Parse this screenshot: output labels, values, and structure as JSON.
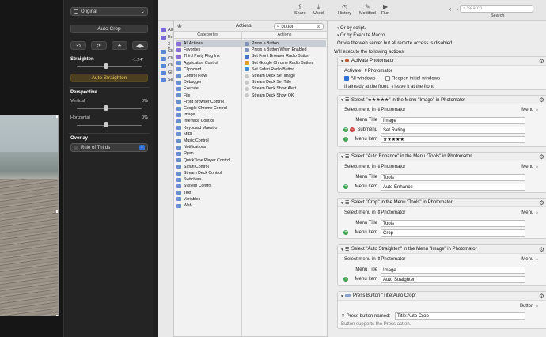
{
  "photomator": {
    "preset_select": "Original",
    "auto_crop_label": "Auto Crop",
    "straighten_title": "Straighten",
    "straighten_value": "-1.24°",
    "auto_straighten_label": "Auto Straighten",
    "perspective_title": "Perspective",
    "vertical_label": "Vertical",
    "vertical_value": "0%",
    "horizontal_label": "Horizontal",
    "horizontal_value": "0%",
    "overlay_title": "Overlay",
    "overlay_select": "Rule of Thirds"
  },
  "toolbar": {
    "share": "Share",
    "used": "Used",
    "history": "History",
    "modified": "Modified",
    "run": "Run",
    "search_placeholder": "Search",
    "search_label": "Search"
  },
  "strip_labels": [
    "All",
    "En",
    "3 v",
    "Cli",
    "Cli",
    "Cli",
    "Gl",
    "Sa"
  ],
  "actions_popover": {
    "title": "Actions",
    "search_value": "button",
    "categories_header": "Categories",
    "actions_header": "Actions",
    "categories": [
      "All Actions",
      "Favorites",
      "Third Party Plug Ins",
      "Application Control",
      "Clipboard",
      "Control Flow",
      "Debugger",
      "Execute",
      "File",
      "Front Browser Control",
      "Google Chrome Control",
      "Image",
      "Interface Control",
      "Keyboard Maestro",
      "MIDI",
      "Music Control",
      "Notifications",
      "Open",
      "QuickTime Player Control",
      "Safari Control",
      "Stream Deck Control",
      "Switchers",
      "System Control",
      "Text",
      "Variables",
      "Web"
    ],
    "actions": [
      "Press a Button",
      "Press a Button When Enabled",
      "Set Front Browser Radio Button",
      "Set Google Chrome Radio Button",
      "Set Safari Radio Button",
      "Stream Deck Set Image",
      "Stream Deck Set Title",
      "Stream Deck Show Alert",
      "Stream Deck Show OK"
    ]
  },
  "editor": {
    "trigger_line1": "Or by script.",
    "trigger_line2": "Or by Execute Macro",
    "web_line": "Or via the web server but all remote access is disabled.",
    "will_execute": "Will execute the following actions:",
    "activate": {
      "title": "Activate Photomator",
      "activate_label": "Activate:",
      "app": "Photomator",
      "all_windows": "All windows",
      "reopen": "Reopen initial windows",
      "front_label": "If already at the front:",
      "front_value": "leave it at the front"
    },
    "select_menu_label": "Select menu in",
    "app_name": "Photomator",
    "menu_dropdown": "Menu",
    "menu_title_label": "Menu Title",
    "submenu_label": "Submenu",
    "menu_item_label": "Menu Item",
    "rating": {
      "title": "Select \"★★★★★\" in the Menu \"Image\" in Photomator",
      "menu_title": "Image",
      "submenu": "Set Rating",
      "menu_item": "★★★★★"
    },
    "enhance": {
      "title": "Select \"Auto Enhance\" in the Menu \"Tools\" in Photomator",
      "menu_title": "Tools",
      "menu_item": "Auto Enhance"
    },
    "crop": {
      "title": "Select \"Crop\" in the Menu \"Tools\" in Photomator",
      "menu_title": "Tools",
      "menu_item": "Crop"
    },
    "straighten": {
      "title": "Select \"Auto Straighten\" in the Menu \"Image\" in Photomator",
      "menu_title": "Image",
      "menu_item": "Auto Straighten"
    },
    "press": {
      "title": "Press Button \"Title:Auto Crop\"",
      "type": "Button",
      "named_label": "Press button named:",
      "named_value": "Title:Auto Crop",
      "support": "Button supports the Press action."
    }
  }
}
